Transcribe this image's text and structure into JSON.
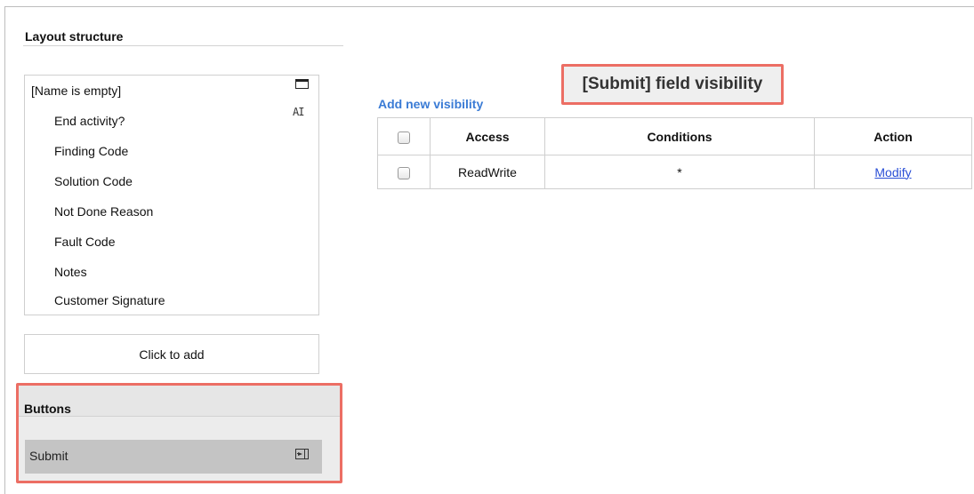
{
  "layout": {
    "title": "Layout structure",
    "root_item": "[Name is empty]",
    "items": [
      "End activity?",
      "Finding Code",
      "Solution Code",
      "Not Done Reason",
      "Fault Code",
      "Notes",
      "Customer Signature"
    ],
    "text_icon_glyph": "AI",
    "click_to_add": "Click to add"
  },
  "buttons": {
    "title": "Buttons",
    "items": [
      "Submit"
    ]
  },
  "visibility": {
    "title": "[Submit] field visibility",
    "add_link": "Add new visibility",
    "columns": [
      "Access",
      "Conditions",
      "Action"
    ],
    "rows": [
      {
        "access": "ReadWrite",
        "conditions": "*",
        "action": "Modify"
      }
    ]
  },
  "colors": {
    "highlight_border": "#ec6e64",
    "link": "#3a7bd5",
    "selected_row": "#c4c4c4"
  },
  "icons": {
    "root_item": "window-icon",
    "end_activity_item": "text-cursor-icon",
    "submit_button": "exit-arrow-icon"
  }
}
